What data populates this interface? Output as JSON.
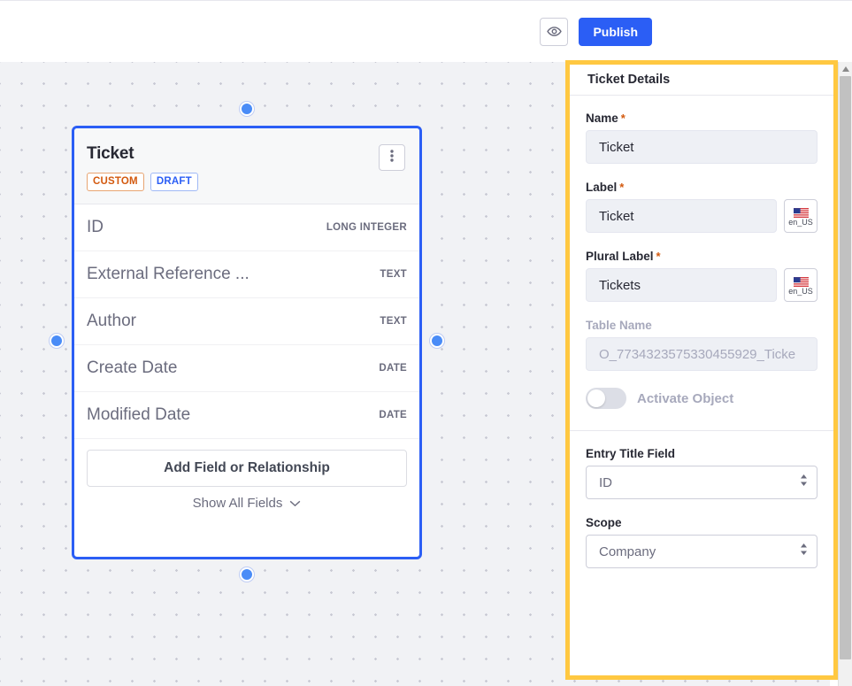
{
  "header": {
    "preview_icon": "eye-icon",
    "publish_label": "Publish"
  },
  "card": {
    "title": "Ticket",
    "menu_icon": "kebab-menu-icon",
    "badges": [
      {
        "label": "CUSTOM",
        "color": "#d3590e"
      },
      {
        "label": "DRAFT",
        "color": "#2b5ef5"
      }
    ],
    "fields": [
      {
        "name": "ID",
        "type": "LONG INTEGER"
      },
      {
        "name": "External Reference ...",
        "type": "TEXT"
      },
      {
        "name": "Author",
        "type": "TEXT"
      },
      {
        "name": "Create Date",
        "type": "DATE"
      },
      {
        "name": "Modified Date",
        "type": "DATE"
      }
    ],
    "add_field_label": "Add Field or Relationship",
    "show_all_label": "Show All Fields",
    "show_all_icon": "chevron-down-icon",
    "selection_color": "#2b5ef5"
  },
  "panel": {
    "highlight_color": "#ffc841",
    "title": "Ticket Details",
    "name": {
      "label": "Name",
      "required": "*",
      "value": "Ticket"
    },
    "label_field": {
      "label": "Label",
      "required": "*",
      "value": "Ticket",
      "locale": "en_US",
      "flag_icon": "us-flag-icon"
    },
    "plural_label": {
      "label": "Plural Label",
      "required": "*",
      "value": "Tickets",
      "locale": "en_US",
      "flag_icon": "us-flag-icon"
    },
    "table_name": {
      "label": "Table Name",
      "value": "O_7734323575330455929_Ticke"
    },
    "activate_object": {
      "label": "Activate Object",
      "state": "off"
    },
    "entry_title_field": {
      "label": "Entry Title Field",
      "value": "ID"
    },
    "scope": {
      "label": "Scope",
      "value": "Company"
    }
  },
  "scrollbar": {
    "up_icon": "scroll-up-arrow-icon"
  }
}
